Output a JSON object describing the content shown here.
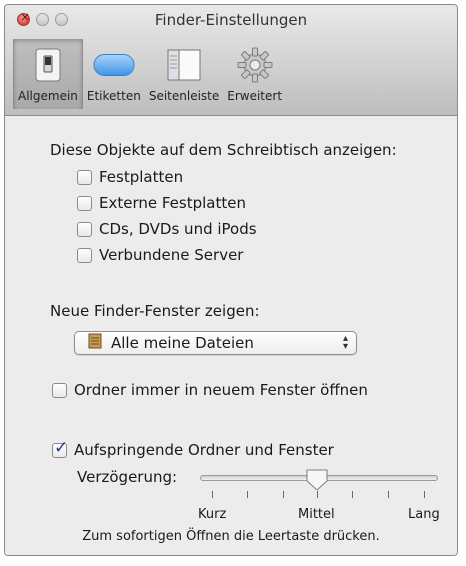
{
  "window": {
    "title": "Finder-Einstellungen"
  },
  "toolbar": {
    "items": [
      {
        "label": "Allgemein",
        "icon": "switch-icon",
        "selected": true
      },
      {
        "label": "Etiketten",
        "icon": "label-pill-icon",
        "selected": false
      },
      {
        "label": "Seitenleiste",
        "icon": "sidebar-icon",
        "selected": false
      },
      {
        "label": "Erweitert",
        "icon": "gear-icon",
        "selected": false
      }
    ]
  },
  "desktop": {
    "heading": "Diese Objekte auf dem Schreibtisch anzeigen:",
    "options": [
      {
        "label": "Festplatten",
        "checked": false
      },
      {
        "label": "Externe Festplatten",
        "checked": false
      },
      {
        "label": "CDs, DVDs und iPods",
        "checked": false
      },
      {
        "label": "Verbundene Server",
        "checked": false
      }
    ]
  },
  "new_window": {
    "heading": "Neue Finder-Fenster zeigen:",
    "selected": "Alle meine Dateien"
  },
  "open_folders": {
    "label": "Ordner immer in neuem Fenster öffnen",
    "checked": false
  },
  "spring_loaded": {
    "label": "Aufspringende Ordner und Fenster",
    "checked": true,
    "delay_label": "Verzögerung:",
    "delay_value": "Mittel",
    "scale": [
      "Kurz",
      "Mittel",
      "Lang"
    ],
    "hint": "Zum sofortigen Öffnen die Leertaste drücken."
  },
  "colors": {
    "accent": "#5aa9ef",
    "checkmark": "#1b3f85"
  }
}
